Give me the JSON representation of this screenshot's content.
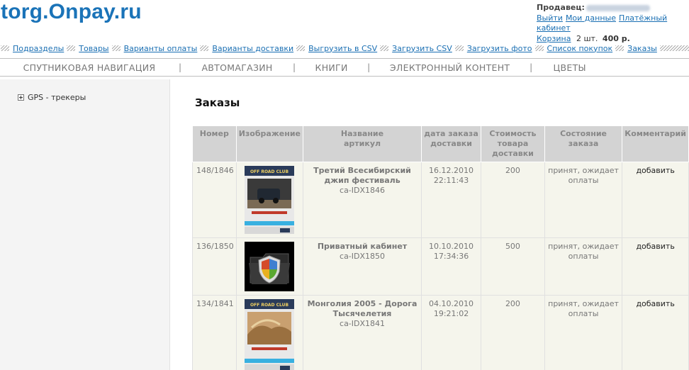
{
  "header": {
    "logo": "torg.Onpay.ru",
    "seller_label": "Продавец:",
    "links": {
      "logout": "Выйти",
      "my_data": "Мои данные",
      "payment_cabinet": "Платёжный кабинет"
    },
    "cart": {
      "label": "Корзина",
      "count": "2 шт.",
      "total": "400 р."
    }
  },
  "topnav": [
    "Подразделы",
    "Товары",
    "Варианты оплаты",
    "Варианты доставки",
    "Выгрузить в CSV",
    "Загрузить CSV",
    "Загрузить фото",
    "Список покупок",
    "Заказы"
  ],
  "categories": [
    "СПУТНИКОВАЯ НАВИГАЦИЯ",
    "АВТОМАГАЗИН",
    "КНИГИ",
    "ЭЛЕКТРОННЫЙ КОНТЕНТ",
    "ЦВЕТЫ"
  ],
  "sidebar": {
    "items": [
      {
        "label": "GPS - трекеры"
      }
    ]
  },
  "page": {
    "title": "Заказы"
  },
  "table": {
    "headers": {
      "number": "Номер",
      "image": "Изображение",
      "name_line1": "Название",
      "name_line2": "артикул",
      "date_line1": "дата заказа",
      "date_line2": "доставки",
      "cost_line1": "Стоимость",
      "cost_line2": "товара",
      "cost_line3": "доставки",
      "status": "Состояние заказа",
      "comment": "Комментарий"
    },
    "rows": [
      {
        "number": "148/1846",
        "image": "offroad-club-jeep",
        "title": "Третий Всесибирский джип фестиваль",
        "sku": "ca-IDX1846",
        "date": "16.12.2010",
        "time": "22:11:43",
        "cost": "200",
        "status": "принят, ожидает оплаты",
        "comment": "добавить"
      },
      {
        "number": "136/1850",
        "image": "private-folder-shield",
        "title": "Приватный кабинет",
        "sku": "ca-IDX1850",
        "date": "10.10.2010",
        "time": "17:34:36",
        "cost": "500",
        "status": "принят, ожидает оплаты",
        "comment": "добавить"
      },
      {
        "number": "134/1841",
        "image": "offroad-club-desert",
        "title": "Монголия 2005 - Дорога Тысячелетия",
        "sku": "ca-IDX1841",
        "date": "04.10.2010",
        "time": "19:21:02",
        "cost": "200",
        "status": "принят, ожидает оплаты",
        "comment": "добавить"
      }
    ]
  },
  "colors": {
    "logo": "#1a73b8",
    "link": "#1a6fb3",
    "header_bg": "#d3d3d3",
    "row_bg": "#f5f5ec"
  }
}
